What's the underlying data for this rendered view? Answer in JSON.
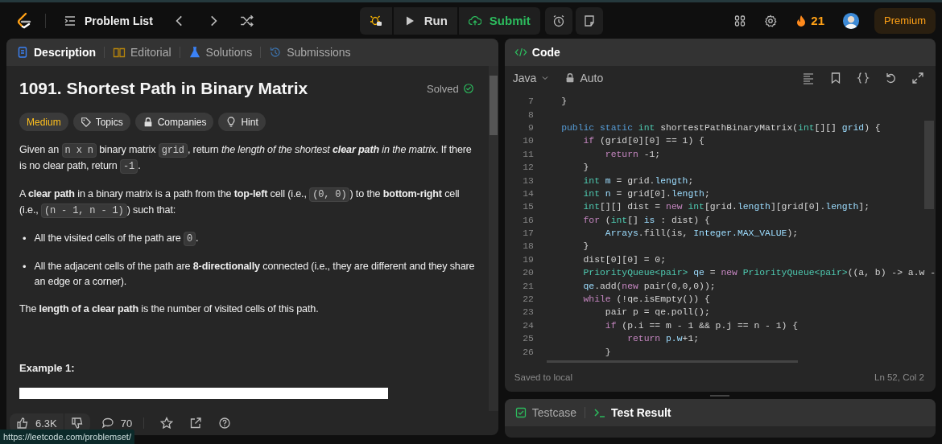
{
  "topbar": {
    "problem_list": "Problem List",
    "run": "Run",
    "submit": "Submit",
    "streak": "21",
    "premium": "Premium"
  },
  "description_panel": {
    "tabs": [
      {
        "label": "Description",
        "kind": "description",
        "selected": true
      },
      {
        "label": "Editorial",
        "kind": "editorial",
        "selected": false
      },
      {
        "label": "Solutions",
        "kind": "solutions",
        "selected": false
      },
      {
        "label": "Submissions",
        "kind": "submissions",
        "selected": false
      }
    ],
    "title": "1091. Shortest Path in Binary Matrix",
    "status": "Solved",
    "tags": [
      {
        "label": "Medium",
        "kind": "difficulty"
      },
      {
        "label": "Topics",
        "kind": "topics"
      },
      {
        "label": "Companies",
        "kind": "companies"
      },
      {
        "label": "Hint",
        "kind": "hint"
      }
    ],
    "paragraphs": [
      {
        "kind": "para",
        "segments": [
          {
            "kind": "text",
            "text": "Given an "
          },
          {
            "kind": "code",
            "text": "n x n"
          },
          {
            "kind": "text",
            "text": " binary matrix "
          },
          {
            "kind": "code",
            "text": "grid"
          },
          {
            "kind": "text",
            "text": ", return "
          },
          {
            "kind": "italic",
            "text": "the length of the shortest **clear path** in the matrix"
          },
          {
            "kind": "text",
            "text": ". If there is no clear path, return "
          },
          {
            "kind": "code",
            "text": "-1"
          },
          {
            "kind": "text",
            "text": "."
          }
        ]
      },
      {
        "kind": "para",
        "segments": [
          {
            "kind": "text",
            "text": "A **clear path** in a binary matrix is a path from the **top-left** cell (i.e., "
          },
          {
            "kind": "code",
            "text": "(0, 0)"
          },
          {
            "kind": "text",
            "text": ") to the **bottom-right** cell (i.e., "
          },
          {
            "kind": "code",
            "text": "(n - 1, n - 1)"
          },
          {
            "kind": "text",
            "text": ") such that:"
          }
        ]
      },
      {
        "kind": "bullet",
        "marker": "•",
        "segments": [
          {
            "kind": "text",
            "text": "All the visited cells of the path are "
          },
          {
            "kind": "code",
            "text": "0"
          },
          {
            "kind": "text",
            "text": "."
          }
        ]
      },
      {
        "kind": "bullet",
        "marker": "•",
        "segments": [
          {
            "kind": "text",
            "text": "All the adjacent cells of the path are **8-directionally** connected (i.e., they are different and they share an edge or a corner)."
          }
        ]
      },
      {
        "kind": "para",
        "segments": [
          {
            "kind": "text",
            "text": "The **length of a clear path** is the number of visited cells of this path."
          }
        ]
      }
    ],
    "example_heading": "Example 1:",
    "likes": "6.3K",
    "comments": "70"
  },
  "code_panel": {
    "title": "Code",
    "language": "Java",
    "mode": "Auto",
    "lines": [
      {
        "number": "7",
        "tokens": [
          {
            "kind": "plain",
            "text": "    }"
          }
        ]
      },
      {
        "number": "8"
      },
      {
        "number": "9",
        "tokens": [
          {
            "kind": "mod",
            "text": "    public static "
          },
          {
            "kind": "type",
            "text": "int "
          },
          {
            "kind": "plain",
            "text": "shortestPathBinaryMatrix("
          },
          {
            "kind": "type",
            "text": "int"
          },
          {
            "kind": "plain",
            "text": "[][] "
          },
          {
            "kind": "var",
            "text": "grid"
          },
          {
            "kind": "plain",
            "text": ") {"
          }
        ]
      },
      {
        "number": "10",
        "tokens": [
          {
            "kind": "kw",
            "text": "        if "
          },
          {
            "kind": "plain",
            "text": "(grid[0][0] == 1) {"
          }
        ]
      },
      {
        "number": "11",
        "tokens": [
          {
            "kind": "kw",
            "text": "            return "
          },
          {
            "kind": "plain",
            "text": "-1;"
          }
        ]
      },
      {
        "number": "12",
        "tokens": [
          {
            "kind": "plain",
            "text": "        }"
          }
        ]
      },
      {
        "number": "13",
        "tokens": [
          {
            "kind": "type",
            "text": "        int "
          },
          {
            "kind": "var",
            "text": "m"
          },
          {
            "kind": "plain",
            "text": " = grid."
          },
          {
            "kind": "var",
            "text": "length"
          },
          {
            "kind": "plain",
            "text": ";"
          }
        ]
      },
      {
        "number": "14",
        "tokens": [
          {
            "kind": "type",
            "text": "        int "
          },
          {
            "kind": "var",
            "text": "n"
          },
          {
            "kind": "plain",
            "text": " = grid[0]."
          },
          {
            "kind": "var",
            "text": "length"
          },
          {
            "kind": "plain",
            "text": ";"
          }
        ]
      },
      {
        "number": "15",
        "tokens": [
          {
            "kind": "type",
            "text": "        int"
          },
          {
            "kind": "plain",
            "text": "[][] dist = "
          },
          {
            "kind": "kw",
            "text": "new "
          },
          {
            "kind": "type",
            "text": "int"
          },
          {
            "kind": "plain",
            "text": "[grid."
          },
          {
            "kind": "var",
            "text": "length"
          },
          {
            "kind": "plain",
            "text": "][grid[0]."
          },
          {
            "kind": "var",
            "text": "length"
          },
          {
            "kind": "plain",
            "text": "];"
          }
        ]
      },
      {
        "number": "16",
        "tokens": [
          {
            "kind": "kw",
            "text": "        for "
          },
          {
            "kind": "plain",
            "text": "("
          },
          {
            "kind": "type",
            "text": "int"
          },
          {
            "kind": "plain",
            "text": "[] "
          },
          {
            "kind": "var",
            "text": "is"
          },
          {
            "kind": "plain",
            "text": " : dist) {"
          }
        ]
      },
      {
        "number": "17",
        "tokens": [
          {
            "kind": "var",
            "text": "            Arrays"
          },
          {
            "kind": "plain",
            "text": ".fill(is, "
          },
          {
            "kind": "var",
            "text": "Integer.MAX_VALUE"
          },
          {
            "kind": "plain",
            "text": ");"
          }
        ]
      },
      {
        "number": "18",
        "tokens": [
          {
            "kind": "plain",
            "text": "        }"
          }
        ]
      },
      {
        "number": "19",
        "tokens": [
          {
            "kind": "plain",
            "text": "        dist[0][0] = 0;"
          }
        ]
      },
      {
        "number": "20",
        "tokens": [
          {
            "kind": "type",
            "text": "        PriorityQueue<pair> "
          },
          {
            "kind": "var",
            "text": "qe"
          },
          {
            "kind": "plain",
            "text": " = "
          },
          {
            "kind": "kw",
            "text": "new "
          },
          {
            "kind": "type",
            "text": "PriorityQueue<pair>"
          },
          {
            "kind": "plain",
            "text": "((a, b) -> a.w -"
          }
        ]
      },
      {
        "number": "21",
        "tokens": [
          {
            "kind": "var",
            "text": "        qe"
          },
          {
            "kind": "plain",
            "text": ".add("
          },
          {
            "kind": "kw",
            "text": "new "
          },
          {
            "kind": "plain",
            "text": "pair(0,0,0));"
          }
        ]
      },
      {
        "number": "22",
        "tokens": [
          {
            "kind": "kw",
            "text": "        while "
          },
          {
            "kind": "plain",
            "text": "(!qe.isEmpty()) {"
          }
        ]
      },
      {
        "number": "23",
        "tokens": [
          {
            "kind": "plain",
            "text": "            pair p = qe.poll();"
          }
        ]
      },
      {
        "number": "24",
        "tokens": [
          {
            "kind": "kw",
            "text": "            if "
          },
          {
            "kind": "plain",
            "text": "(p.i == m - 1 && p.j == n - 1) {"
          }
        ]
      },
      {
        "number": "25",
        "tokens": [
          {
            "kind": "kw",
            "text": "                return "
          },
          {
            "kind": "var",
            "text": "p.w"
          },
          {
            "kind": "plain",
            "text": "+1;"
          }
        ]
      },
      {
        "number": "26",
        "tokens": [
          {
            "kind": "plain",
            "text": "            }"
          }
        ]
      }
    ],
    "save_status": "Saved to local",
    "cursor": "Ln 52, Col 2"
  },
  "result_panel": {
    "tabs": [
      {
        "label": "Testcase",
        "kind": "testcase",
        "selected": false
      },
      {
        "label": "Test Result",
        "kind": "result",
        "selected": true
      }
    ]
  },
  "status_url": "https://leetcode.com/problemset/"
}
